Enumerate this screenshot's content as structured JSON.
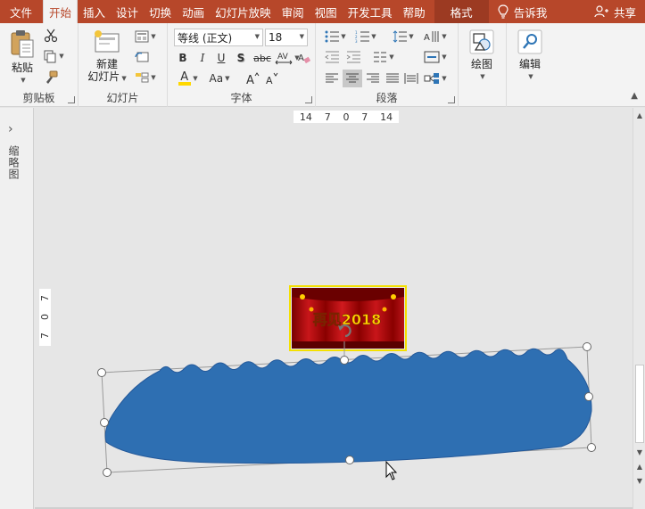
{
  "tabs": [
    {
      "label": "文件",
      "active": false
    },
    {
      "label": "开始",
      "active": true
    },
    {
      "label": "插入",
      "active": false
    },
    {
      "label": "设计",
      "active": false
    },
    {
      "label": "切换",
      "active": false
    },
    {
      "label": "动画",
      "active": false
    },
    {
      "label": "幻灯片放映",
      "active": false
    },
    {
      "label": "审阅",
      "active": false
    },
    {
      "label": "视图",
      "active": false
    },
    {
      "label": "开发工具",
      "active": false
    },
    {
      "label": "帮助",
      "active": false
    }
  ],
  "context_tab": "格式",
  "tell_me": "告诉我",
  "share": "共享",
  "ribbon": {
    "clipboard": {
      "paste": "粘贴",
      "label": "剪贴板"
    },
    "slides": {
      "new_slide_line1": "新建",
      "new_slide_line2": "幻灯片",
      "label": "幻灯片"
    },
    "font": {
      "font_name": "等线 (正文)",
      "font_size": "18",
      "label": "字体",
      "bold": "B",
      "italic": "I",
      "underline": "U",
      "shadow": "S",
      "strike": "abc",
      "font_color_glyph": "A",
      "aa": "Aa"
    },
    "paragraph": {
      "label": "段落"
    },
    "drawing": {
      "label": "绘图"
    },
    "editing": {
      "label": "编辑"
    }
  },
  "thumbnail_pane_label": "缩略图",
  "ruler_h": [
    "14",
    "7",
    "0",
    "7",
    "14"
  ],
  "ruler_v": [
    "7",
    "0",
    "7"
  ],
  "slide": {
    "picture_text": "再见2018",
    "shape_color": "#2e6fb2",
    "picture_border": "#f4e000"
  },
  "colors": {
    "accent": "#b7472a",
    "context": "#9c3a22",
    "font_color_bar": "#ffd800"
  }
}
